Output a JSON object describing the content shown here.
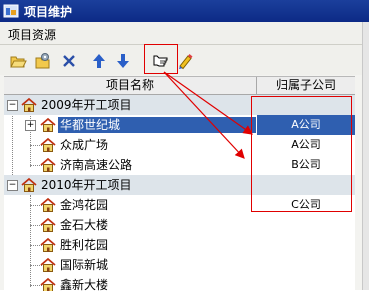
{
  "window": {
    "title": "项目维护"
  },
  "panel": {
    "title": "项目资源"
  },
  "toolbar": {
    "buttons": [
      {
        "name": "open-folder-button",
        "icon": "folder-open-icon"
      },
      {
        "name": "settings-folder-button",
        "icon": "folder-gear-icon"
      },
      {
        "name": "delete-button",
        "icon": "close-icon"
      },
      {
        "name": "move-up-button",
        "icon": "arrow-up-icon"
      },
      {
        "name": "move-down-button",
        "icon": "arrow-down-icon"
      },
      {
        "name": "assign-button",
        "icon": "pointing-hand-icon"
      },
      {
        "name": "edit-button",
        "icon": "pencil-icon"
      }
    ]
  },
  "grid": {
    "columns": [
      "项目名称",
      "归属子公司"
    ],
    "rows": [
      {
        "type": "group",
        "name": "2009年开工项目",
        "company": "",
        "expanded": true
      },
      {
        "type": "item",
        "name": "华都世纪城",
        "company": "A公司",
        "selected": true,
        "has_children": true
      },
      {
        "type": "item",
        "name": "众成广场",
        "company": "A公司"
      },
      {
        "type": "item",
        "name": "济南高速公路",
        "company": "B公司"
      },
      {
        "type": "group",
        "name": "2010年开工项目",
        "company": "",
        "expanded": true
      },
      {
        "type": "item",
        "name": "金鸿花园",
        "company": "C公司"
      },
      {
        "type": "item",
        "name": "金石大楼",
        "company": ""
      },
      {
        "type": "item",
        "name": "胜利花园",
        "company": ""
      },
      {
        "type": "item",
        "name": "国际新城",
        "company": ""
      },
      {
        "type": "item",
        "name": "鑫新大楼",
        "company": ""
      }
    ]
  },
  "colors": {
    "title_bar": "#0c2a86",
    "selection": "#2f5fb0",
    "group_row": "#dde4ea",
    "annotation": "#e00000"
  }
}
